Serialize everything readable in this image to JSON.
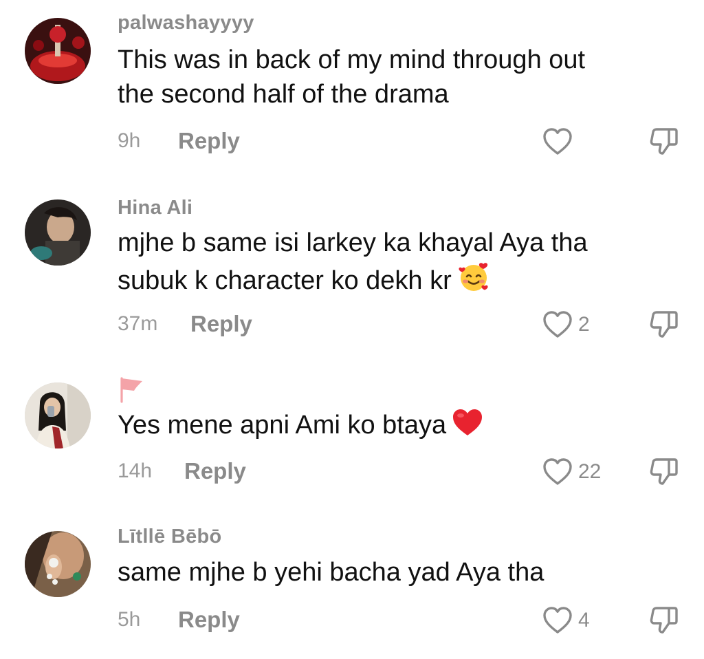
{
  "comments": [
    {
      "username": "palwashayyyy",
      "text": [
        "This was in back of my mind through out",
        "the second half of the drama"
      ],
      "time": "9h",
      "reply": "Reply",
      "likes": ""
    },
    {
      "username": "Hina Ali",
      "text": [
        "mjhe b same isi larkey ka khayal Aya tha",
        "subuk k character ko dekh kr"
      ],
      "time": "37m",
      "reply": "Reply",
      "likes": "2"
    },
    {
      "username": "",
      "text": [
        "Yes mene apni Ami ko btaya"
      ],
      "time": "14h",
      "reply": "Reply",
      "likes": "22"
    },
    {
      "username": "Lītllē Bēbō",
      "text": [
        "same mjhe b yehi bacha yad Aya tha"
      ],
      "time": "5h",
      "reply": "Reply",
      "likes": "4"
    }
  ],
  "icons": {
    "like": "heart-outline-icon",
    "dislike": "thumbs-down-outline-icon",
    "flag": "flag-icon",
    "emoji_love": "smiling-face-with-hearts-emoji",
    "emoji_heart": "red-heart-emoji"
  },
  "colors": {
    "username": "#8a8a8a",
    "text": "#111111",
    "meta": "#9a9a9a",
    "heart_emoji": "#e8232f",
    "flag": "#f4a3a8"
  }
}
